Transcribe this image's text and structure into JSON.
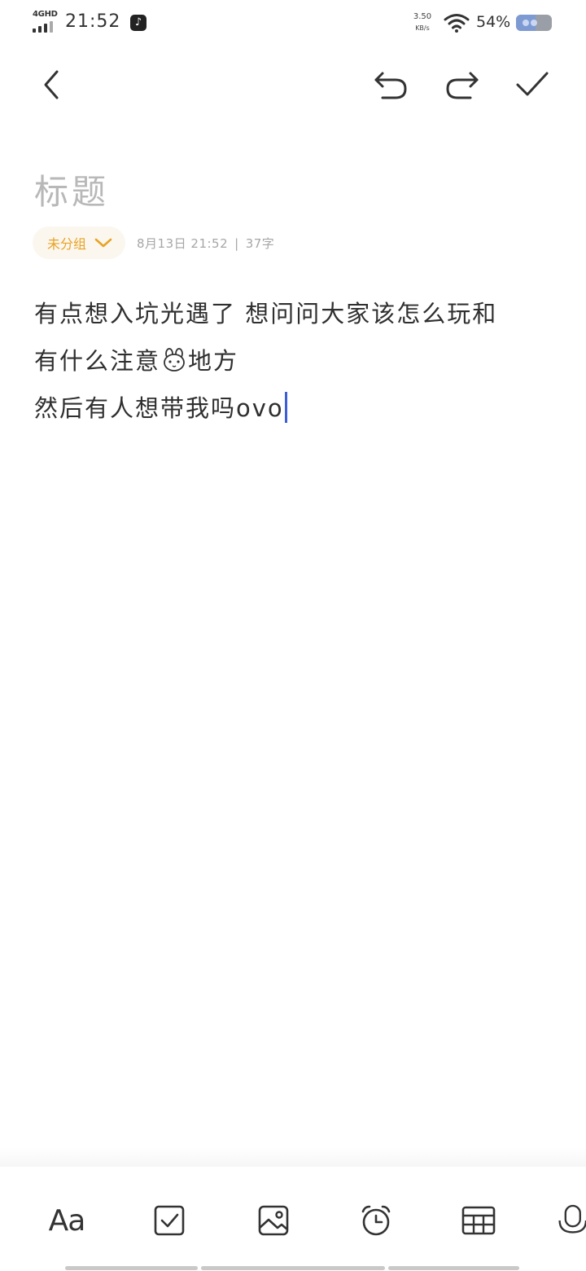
{
  "status_bar": {
    "network": "4GHD",
    "time": "21:52",
    "net_speed_value": "3.50",
    "net_speed_unit": "KB/s",
    "battery_percent": "54%",
    "battery_level": 0.54,
    "icons": [
      "signal-icon",
      "tiktok-icon",
      "wifi-icon",
      "battery-icon"
    ]
  },
  "toolbar": {
    "icons": [
      "back-icon",
      "undo-icon",
      "redo-icon",
      "check-icon"
    ]
  },
  "note": {
    "title_placeholder": "标题",
    "group_label": "未分组",
    "date": "8月13日 21:52",
    "divider": "|",
    "char_count": "37字",
    "lines": [
      "有点想入坑光遇了 想问问大家该怎么玩和",
      "有什么注意",
      "地方",
      "然后有人想带我吗ovo"
    ]
  },
  "bottom_toolbar": {
    "format_label": "Aa",
    "icons": [
      "checkbox-icon",
      "image-icon",
      "alarm-icon",
      "table-icon",
      "microphone-icon"
    ]
  },
  "colors": {
    "accent_group": "#e8a325",
    "caret": "#3d5fd6",
    "placeholder": "#b8b8b8",
    "text": "#2f2f2f"
  }
}
